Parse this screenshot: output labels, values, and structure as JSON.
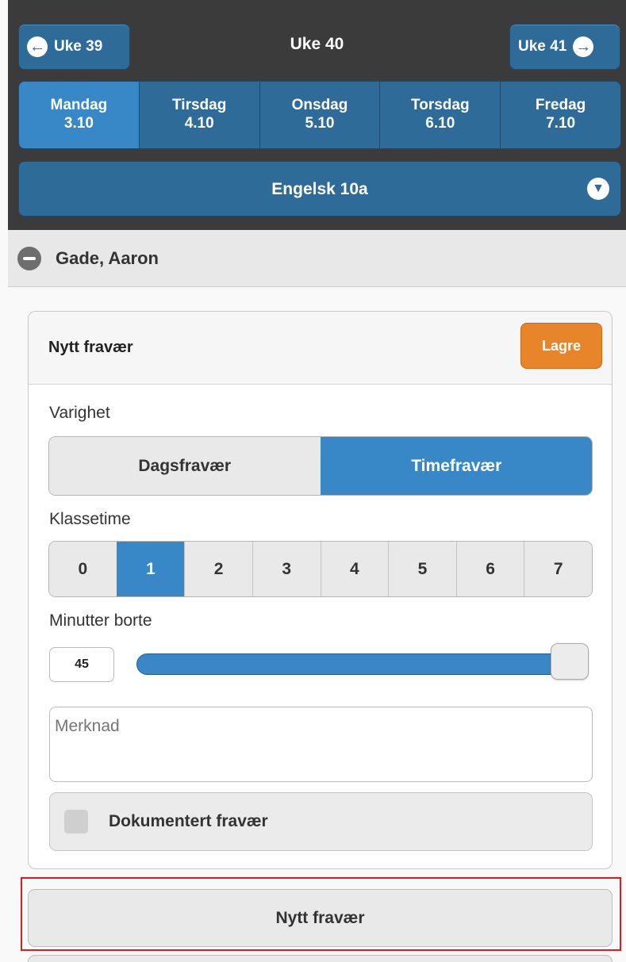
{
  "week_nav": {
    "prev_label": "Uke 39",
    "current": "Uke 40",
    "next_label": "Uke 41"
  },
  "days": [
    {
      "name": "Mandag",
      "date": "3.10"
    },
    {
      "name": "Tirsdag",
      "date": "4.10"
    },
    {
      "name": "Onsdag",
      "date": "5.10"
    },
    {
      "name": "Torsdag",
      "date": "6.10"
    },
    {
      "name": "Fredag",
      "date": "7.10"
    }
  ],
  "active_day": "Mandag",
  "subject": "Engelsk 10a",
  "student": "Gade, Aaron",
  "card": {
    "title": "Nytt fravær",
    "save_label": "Lagre",
    "duration_label": "Varighet",
    "duration_options": [
      "Dagsfravær",
      "Timefravær"
    ],
    "duration_selected": "Timefravær",
    "period_label": "Klassetime",
    "periods": [
      "0",
      "1",
      "2",
      "3",
      "4",
      "5",
      "6",
      "7"
    ],
    "period_selected": "1",
    "minutes_label": "Minutter borte",
    "minutes_value": "45",
    "note_placeholder": "Merknad",
    "documented_label": "Dokumentert fravær"
  },
  "new_absence_label": "Nytt fravær",
  "colors": {
    "header_bg": "#3b3b3b",
    "nav_blue": "#2f6b98",
    "active_blue": "#3887c7",
    "save_orange": "#e8852a",
    "highlight_red": "#e01b1b"
  }
}
